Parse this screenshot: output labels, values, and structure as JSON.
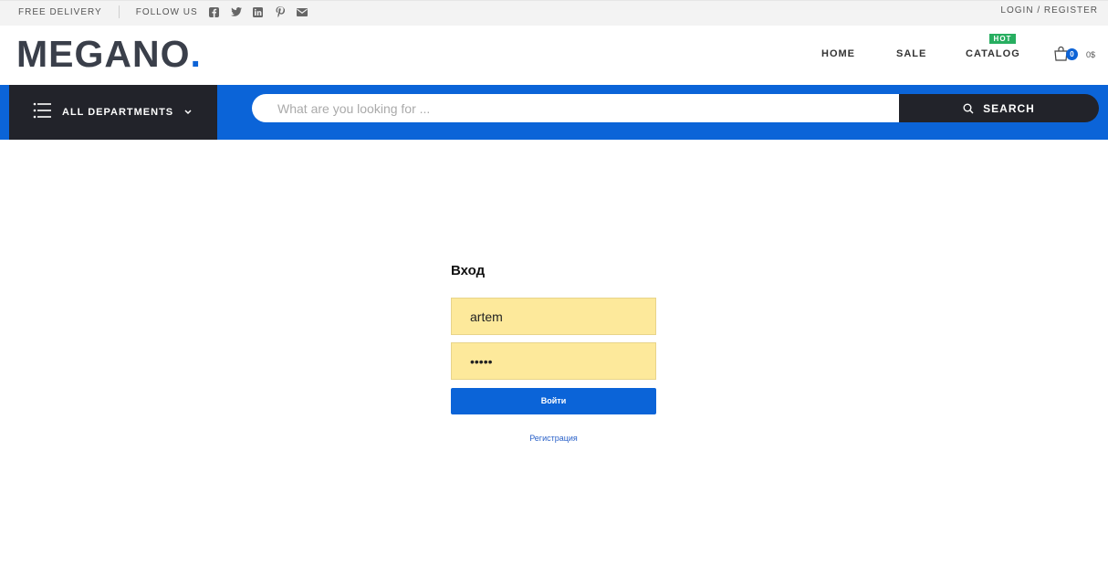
{
  "topbar": {
    "free_delivery": "FREE DELIVERY",
    "follow_us": "FOLLOW US",
    "social_icons": [
      "facebook-icon",
      "twitter-icon",
      "linkedin-icon",
      "pinterest-icon",
      "mail-icon"
    ],
    "auth_link": "LOGIN / REGISTER"
  },
  "header": {
    "logo_text": "MEGANO",
    "logo_dot": ".",
    "nav": {
      "home": "HOME",
      "sale": "SALE",
      "catalog": "CATALOG",
      "catalog_badge": "HOT"
    },
    "cart": {
      "count": "0",
      "total": "0$"
    }
  },
  "searchbar": {
    "departments_label": "ALL DEPARTMENTS",
    "placeholder": "What are you looking for ...",
    "button_label": "SEARCH"
  },
  "login": {
    "title": "Вход",
    "username_value": "artem",
    "password_value": "•••••",
    "submit_label": "Войти",
    "register_link": "Регистрация"
  },
  "colors": {
    "brand_blue": "#0b64d8",
    "dark": "#22232a",
    "autofill_yellow": "#fde99b",
    "hot_badge": "#27ae60"
  }
}
